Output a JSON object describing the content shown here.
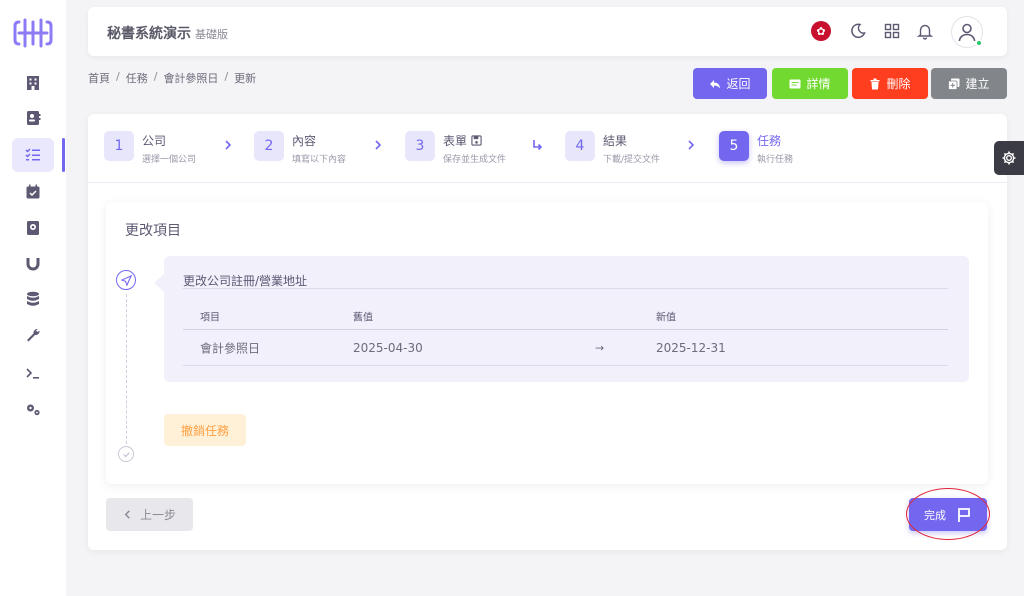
{
  "header": {
    "app_title": "秘書系統演示",
    "app_subtitle": "基礎版",
    "flag_glyph": "✿"
  },
  "breadcrumb": [
    "首頁",
    "任務",
    "會計參照日",
    "更新"
  ],
  "breadcrumb_separator": "/",
  "actions": {
    "back": "返回",
    "details": "詳情",
    "delete": "刪除",
    "create": "建立"
  },
  "steps": [
    {
      "num": "1",
      "title": "公司",
      "sub": "選擇一個公司"
    },
    {
      "num": "2",
      "title": "內容",
      "sub": "填寫以下內容"
    },
    {
      "num": "3",
      "title": "表單",
      "sub": "保存並生成文件"
    },
    {
      "num": "4",
      "title": "結果",
      "sub": "下載/提交文件"
    },
    {
      "num": "5",
      "title": "任務",
      "sub": "執行任務"
    }
  ],
  "panel": {
    "title": "更改項目",
    "change_title": "更改公司註冊/營業地址",
    "table_headers": [
      "項目",
      "舊值",
      "新值"
    ],
    "rows": [
      {
        "item": "會計參照日",
        "old": "2025-04-30",
        "arrow": "→",
        "new": "2025-12-31"
      }
    ],
    "revoke_label": "撤銷任務"
  },
  "footer": {
    "prev_label": "上一步",
    "done_label": "完成"
  },
  "colors": {
    "primary": "#7367f0",
    "success": "#72d930",
    "danger": "#ff3d1f",
    "secondary": "#82868b",
    "warning": "#ff9f43"
  }
}
